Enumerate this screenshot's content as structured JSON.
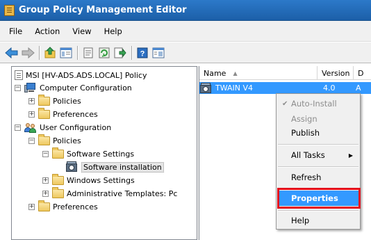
{
  "window": {
    "title": "Group Policy Management Editor"
  },
  "menubar": {
    "items": [
      "File",
      "Action",
      "View",
      "Help"
    ]
  },
  "toolbar": {
    "buttons": [
      "back-icon",
      "forward-icon",
      "up-icon",
      "show-hide-tree-icon",
      "properties-icon",
      "refresh-icon",
      "export-icon",
      "help-icon",
      "console-tree-icon"
    ]
  },
  "tree": {
    "root": "MSI [HV-ADS.ADS.LOCAL] Policy",
    "computer_config": "Computer Configuration",
    "cc_policies": "Policies",
    "cc_preferences": "Preferences",
    "user_config": "User Configuration",
    "uc_policies": "Policies",
    "software_settings": "Software Settings",
    "software_installation": "Software installation",
    "windows_settings": "Windows Settings",
    "admin_templates": "Administrative Templates: Pc",
    "uc_preferences": "Preferences",
    "expander_plus": "+",
    "expander_minus": "−"
  },
  "list": {
    "columns": {
      "name": "Name",
      "version": "Version",
      "d": "D"
    },
    "rows": [
      {
        "name": "TWAIN V4",
        "version": "4.0",
        "d": "A"
      }
    ]
  },
  "context_menu": {
    "auto_install": "Auto-Install",
    "assign": "Assign",
    "publish": "Publish",
    "all_tasks": "All Tasks",
    "refresh": "Refresh",
    "properties": "Properties",
    "help": "Help",
    "check_glyph": "✔",
    "submenu_glyph": "▶"
  },
  "colors": {
    "titlebar": "#1c5fa8",
    "selection": "#3399ff",
    "highlight_outline": "#e4101c"
  }
}
